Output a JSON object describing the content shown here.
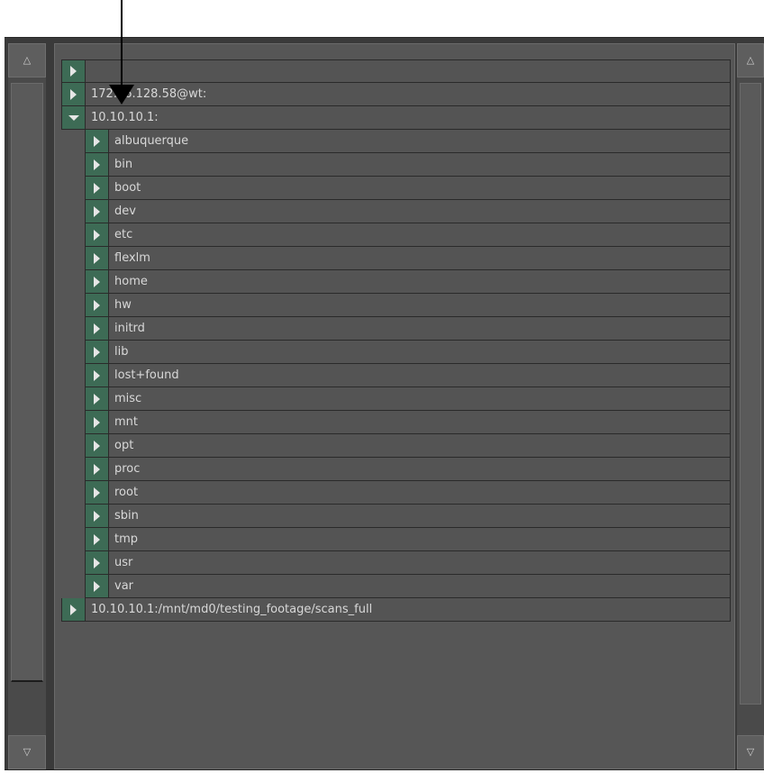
{
  "scroll": {
    "up_glyph": "△",
    "down_glyph": "▽"
  },
  "tree": {
    "top_nodes": [
      {
        "label": "",
        "expanded": false
      },
      {
        "label": "172.16.128.58@wt:",
        "expanded": false
      },
      {
        "label": "10.10.10.1:",
        "expanded": true
      }
    ],
    "children": [
      "albuquerque",
      "bin",
      "boot",
      "dev",
      "etc",
      "flexlm",
      "home",
      "hw",
      "initrd",
      "lib",
      "lost+found",
      "misc",
      "mnt",
      "opt",
      "proc",
      "root",
      "sbin",
      "tmp",
      "usr",
      "var"
    ],
    "bottom_node": {
      "label": "10.10.10.1:/mnt/md0/testing_footage/scans_full",
      "expanded": false
    }
  },
  "colors": {
    "expander_green": "#3d6b55",
    "row_bg": "#545454",
    "panel_bg": "#565656"
  }
}
